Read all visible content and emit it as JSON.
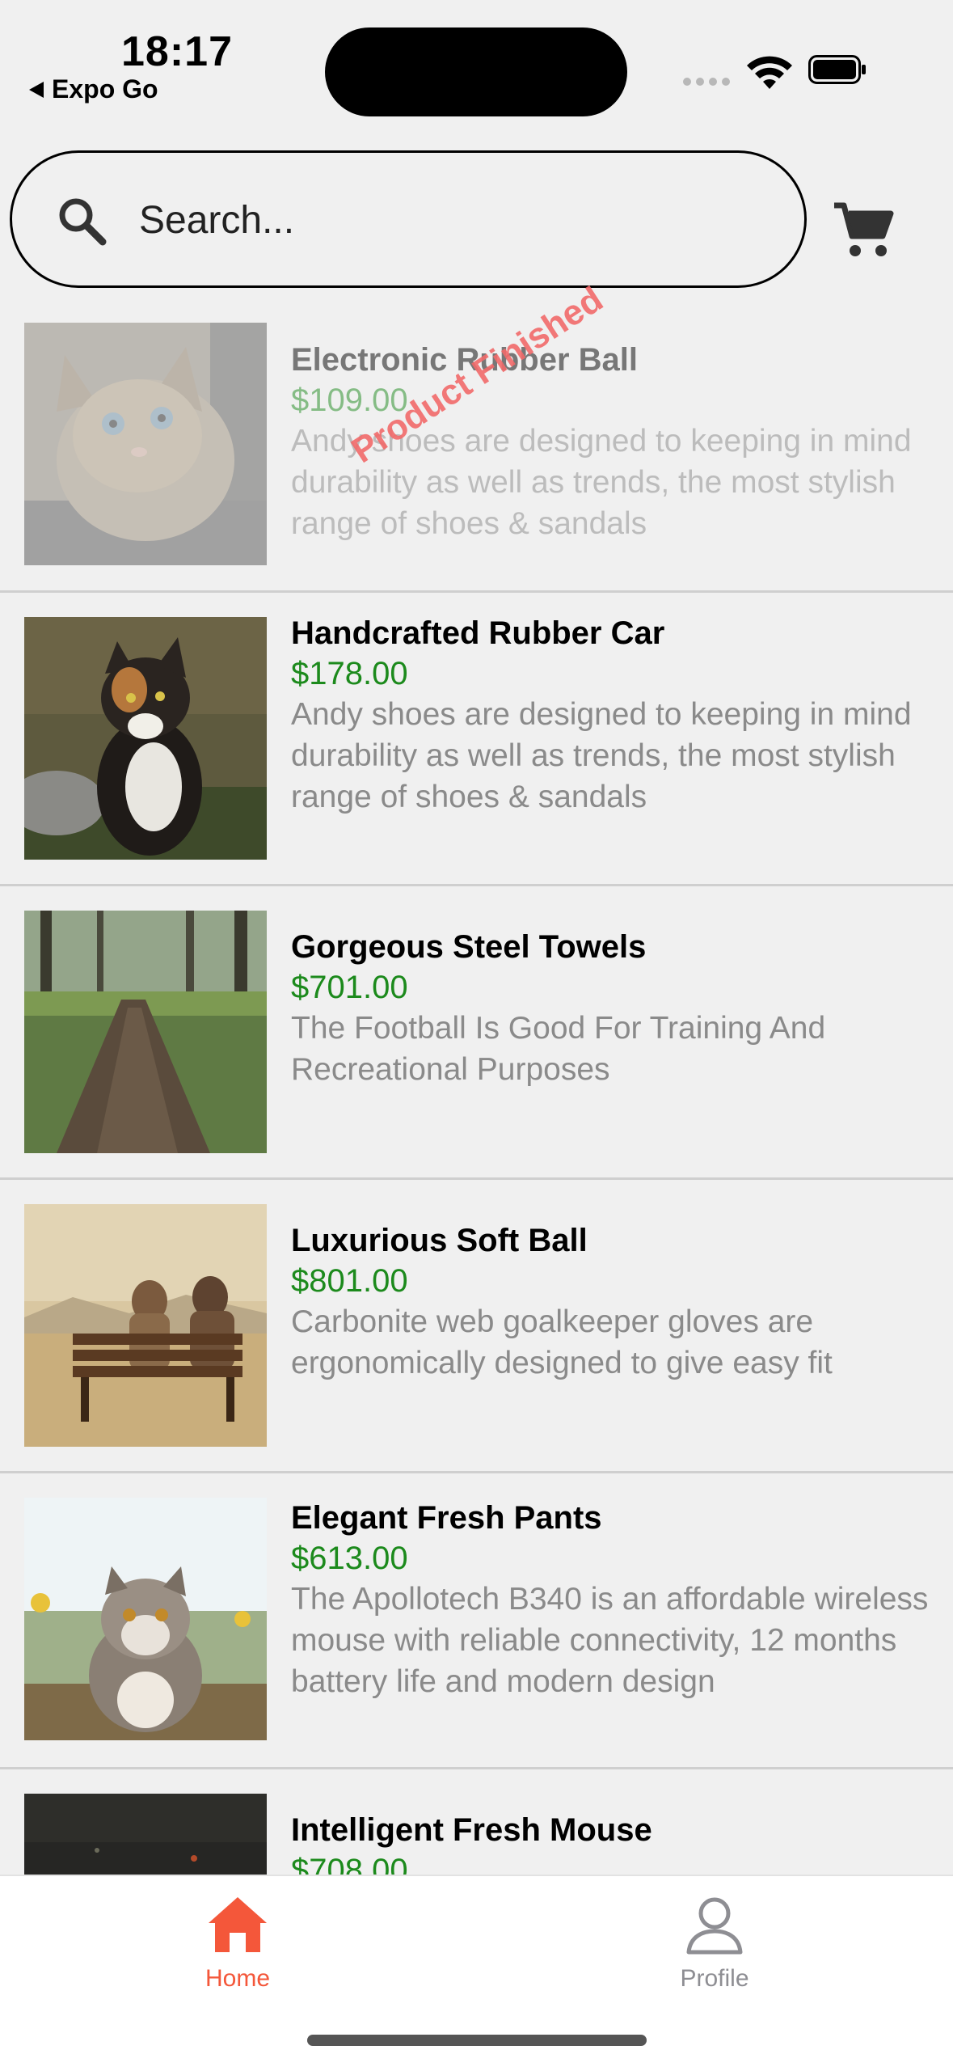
{
  "status_bar": {
    "time": "18:17",
    "back_app": "Expo Go"
  },
  "search": {
    "placeholder": "Search..."
  },
  "products": [
    {
      "name": "Electronic Rubber Ball",
      "price": "$109.00",
      "description": "Andy shoes are designed to keeping in mind durability as well as trends, the most stylish range of shoes & sandals",
      "stamp": "Product Finished",
      "image": "kitten-photo"
    },
    {
      "name": "Handcrafted Rubber Car",
      "price": "$178.00",
      "description": "Andy shoes are designed to keeping in mind durability as well as trends, the most stylish range of shoes & sandals",
      "image": "calico-cat-photo"
    },
    {
      "name": "Gorgeous Steel Towels",
      "price": "$701.00",
      "description": "The Football Is Good For Training And Recreational Purposes",
      "image": "forest-path-photo"
    },
    {
      "name": "Luxurious Soft Ball",
      "price": "$801.00",
      "description": "Carbonite web goalkeeper gloves are ergonomically designed to give easy fit",
      "image": "bench-couple-photo"
    },
    {
      "name": "Elegant Fresh Pants",
      "price": "$613.00",
      "description": "The Apollotech B340 is an affordable wireless mouse with reliable connectivity, 12 months battery life and modern design",
      "image": "persian-cat-photo"
    },
    {
      "name": "Intelligent Fresh Mouse",
      "price": "$708.00",
      "description": "",
      "image": "night-city-photo"
    }
  ],
  "tab_bar": {
    "home_label": "Home",
    "profile_label": "Profile",
    "active_color": "#f4573a",
    "inactive_color": "#8e8e93"
  }
}
